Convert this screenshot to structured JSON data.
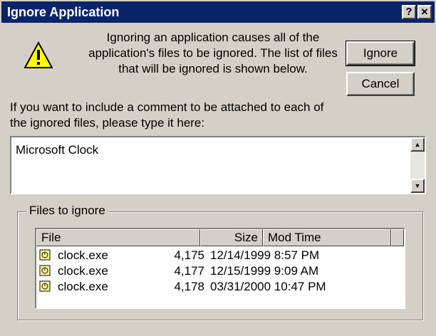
{
  "window": {
    "title": "Ignore Application",
    "help_label": "?",
    "close_label": "✕"
  },
  "message": {
    "line1": "Ignoring an application causes all of the",
    "line2": "application's files to be ignored.  The list of files",
    "line3": "that will be ignored is shown below."
  },
  "buttons": {
    "ignore": "Ignore",
    "cancel": "Cancel"
  },
  "prompt": {
    "line1": "If you want to include a comment to be attached to each of",
    "line2": "the ignored files, please type it here:"
  },
  "comment": {
    "value": "Microsoft Clock"
  },
  "files_group": {
    "label": "Files to ignore",
    "columns": {
      "file": "File",
      "size": "Size",
      "mod_time": "Mod Time"
    },
    "rows": [
      {
        "file": "clock.exe",
        "size": "4,175",
        "mod_time": "12/14/1999 8:57 PM"
      },
      {
        "file": "clock.exe",
        "size": "4,177",
        "mod_time": "12/15/1999 9:09 AM"
      },
      {
        "file": "clock.exe",
        "size": "4,178",
        "mod_time": "03/31/2000 10:47 PM"
      }
    ]
  },
  "icons": {
    "warning": "warning-icon",
    "file": "file-icon",
    "scroll_up": "scroll-up-icon",
    "scroll_down": "scroll-down-icon"
  }
}
